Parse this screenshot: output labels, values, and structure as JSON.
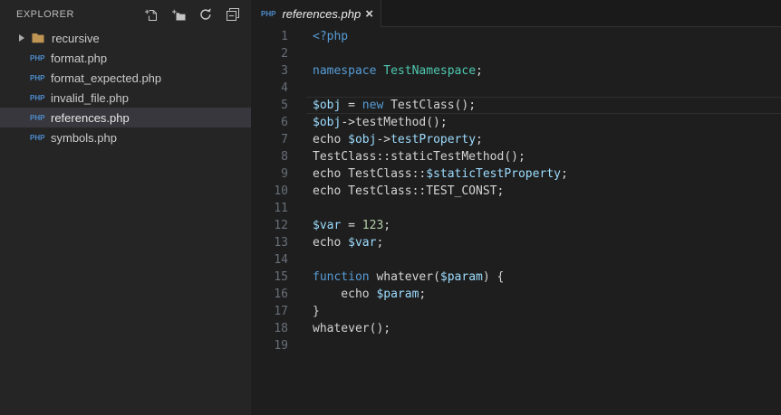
{
  "colors": {
    "editor_bg": "#1E1E1E",
    "sidebar_bg": "#252526",
    "selected_row_bg": "#37373D",
    "keyword": "#569CD6",
    "variable": "#9CDCFE",
    "class_name": "#4EC9B0",
    "number": "#B5CEA8",
    "default_text": "#D4D4D4",
    "php_icon_blue": "#4D8CCC",
    "line_number": "#686F78"
  },
  "sidebar": {
    "title": "EXPLORER",
    "php_badge": "PHP",
    "actions": [
      {
        "name": "new-file"
      },
      {
        "name": "new-folder"
      },
      {
        "name": "refresh"
      },
      {
        "name": "collapse-all"
      }
    ],
    "tree": [
      {
        "type": "folder",
        "label": "recursive",
        "selected": false
      },
      {
        "type": "php-file",
        "label": "format.php",
        "selected": false
      },
      {
        "type": "php-file",
        "label": "format_expected.php",
        "selected": false
      },
      {
        "type": "php-file",
        "label": "invalid_file.php",
        "selected": false
      },
      {
        "type": "php-file",
        "label": "references.php",
        "selected": true
      },
      {
        "type": "php-file",
        "label": "symbols.php",
        "selected": false
      }
    ]
  },
  "tabbar": {
    "tabs": [
      {
        "icon": "PHP",
        "title": "references.php",
        "close_label": "×",
        "active": true,
        "preview": true
      }
    ]
  },
  "editor": {
    "lines": [
      {
        "num": "1",
        "current": false,
        "tokens": [
          {
            "c": "kw",
            "t": "<?php"
          }
        ]
      },
      {
        "num": "2",
        "current": false,
        "tokens": []
      },
      {
        "num": "3",
        "current": false,
        "tokens": [
          {
            "c": "kw",
            "t": "namespace"
          },
          {
            "c": "d",
            "t": " "
          },
          {
            "c": "cls",
            "t": "TestNamespace"
          },
          {
            "c": "d",
            "t": ";"
          }
        ]
      },
      {
        "num": "4",
        "current": false,
        "tokens": []
      },
      {
        "num": "5",
        "current": true,
        "tokens": [
          {
            "c": "var",
            "t": "$obj"
          },
          {
            "c": "d",
            "t": " = "
          },
          {
            "c": "kw",
            "t": "new"
          },
          {
            "c": "d",
            "t": " TestClass();"
          }
        ]
      },
      {
        "num": "6",
        "current": false,
        "tokens": [
          {
            "c": "var",
            "t": "$obj"
          },
          {
            "c": "d",
            "t": "->testMethod();"
          }
        ]
      },
      {
        "num": "7",
        "current": false,
        "tokens": [
          {
            "c": "d",
            "t": "echo "
          },
          {
            "c": "var",
            "t": "$obj"
          },
          {
            "c": "d",
            "t": "->"
          },
          {
            "c": "var",
            "t": "testProperty"
          },
          {
            "c": "d",
            "t": ";"
          }
        ]
      },
      {
        "num": "8",
        "current": false,
        "tokens": [
          {
            "c": "d",
            "t": "TestClass::staticTestMethod();"
          }
        ]
      },
      {
        "num": "9",
        "current": false,
        "tokens": [
          {
            "c": "d",
            "t": "echo TestClass::"
          },
          {
            "c": "var",
            "t": "$staticTestProperty"
          },
          {
            "c": "d",
            "t": ";"
          }
        ]
      },
      {
        "num": "10",
        "current": false,
        "tokens": [
          {
            "c": "d",
            "t": "echo TestClass::TEST_CONST;"
          }
        ]
      },
      {
        "num": "11",
        "current": false,
        "tokens": []
      },
      {
        "num": "12",
        "current": false,
        "tokens": [
          {
            "c": "var",
            "t": "$var"
          },
          {
            "c": "d",
            "t": " = "
          },
          {
            "c": "num",
            "t": "123"
          },
          {
            "c": "d",
            "t": ";"
          }
        ]
      },
      {
        "num": "13",
        "current": false,
        "tokens": [
          {
            "c": "d",
            "t": "echo "
          },
          {
            "c": "var",
            "t": "$var"
          },
          {
            "c": "d",
            "t": ";"
          }
        ]
      },
      {
        "num": "14",
        "current": false,
        "tokens": []
      },
      {
        "num": "15",
        "current": false,
        "tokens": [
          {
            "c": "kw",
            "t": "function"
          },
          {
            "c": "d",
            "t": " whatever("
          },
          {
            "c": "var",
            "t": "$param"
          },
          {
            "c": "d",
            "t": ") {"
          }
        ]
      },
      {
        "num": "16",
        "current": false,
        "tokens": [
          {
            "c": "d",
            "t": "    echo "
          },
          {
            "c": "var",
            "t": "$param"
          },
          {
            "c": "d",
            "t": ";"
          }
        ]
      },
      {
        "num": "17",
        "current": false,
        "tokens": [
          {
            "c": "d",
            "t": "}"
          }
        ]
      },
      {
        "num": "18",
        "current": false,
        "tokens": [
          {
            "c": "d",
            "t": "whatever();"
          }
        ]
      },
      {
        "num": "19",
        "current": false,
        "tokens": []
      }
    ]
  }
}
